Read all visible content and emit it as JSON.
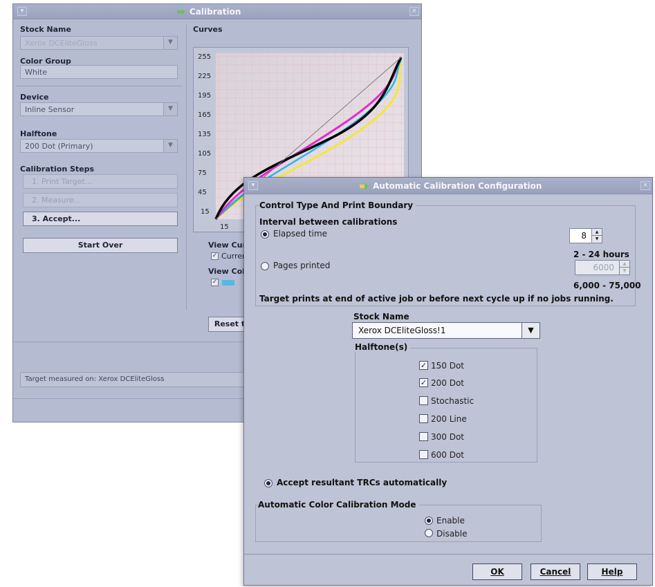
{
  "back_window": {
    "title": "Calibration",
    "stock_name": {
      "label": "Stock Name",
      "value": "Xerox DCEliteGloss"
    },
    "color_group": {
      "label": "Color Group",
      "value": "White"
    },
    "device": {
      "label": "Device",
      "value": "Inline Sensor"
    },
    "halftone": {
      "label": "Halftone",
      "value": "200 Dot (Primary)"
    },
    "calibration_steps": {
      "label": "Calibration Steps",
      "items": [
        "1. Print Target...",
        "2. Measure...",
        "3. Accept..."
      ]
    },
    "start_over": "Start Over",
    "curves_label": "Curves",
    "chart_ticks_y": [
      "255",
      "225",
      "195",
      "165",
      "135",
      "105",
      "75",
      "45",
      "15"
    ],
    "chart_ticks_x": [
      "15"
    ],
    "view_curves_label": "View Curv",
    "current_label": "Curren",
    "view_colors_label": "View Colo",
    "reset_button": "Reset t",
    "status": "Target measured on: Xerox DCEliteGloss"
  },
  "dialog": {
    "title": "Automatic Calibration Configuration",
    "control_group": {
      "title": "Control Type And Print Boundary",
      "interval_label": "Interval between calibrations",
      "elapsed_time": {
        "label": "Elapsed time",
        "value": "8",
        "range": "2 - 24 hours"
      },
      "pages_printed": {
        "label": "Pages printed",
        "value": "6000",
        "range": "6,000 - 75,000"
      },
      "note": "Target prints at end of active job or before next cycle up if no jobs running."
    },
    "stock_name": {
      "label": "Stock Name",
      "value": "Xerox DCEliteGloss!1"
    },
    "halftones": {
      "title": "Halftone(s)",
      "items": [
        {
          "label": "150 Dot",
          "checked": true
        },
        {
          "label": "200 Dot",
          "checked": true
        },
        {
          "label": "Stochastic",
          "checked": false
        },
        {
          "label": "200 Line",
          "checked": false
        },
        {
          "label": "300 Dot",
          "checked": false
        },
        {
          "label": "600 Dot",
          "checked": false
        }
      ]
    },
    "accept_trcs": "Accept resultant TRCs automatically",
    "mode_group": {
      "title": "Automatic Color Calibration Mode",
      "enable": "Enable",
      "disable": "Disable",
      "selected": "Enable"
    },
    "buttons": {
      "ok": "OK",
      "cancel": "Cancel",
      "help": "Help"
    }
  }
}
